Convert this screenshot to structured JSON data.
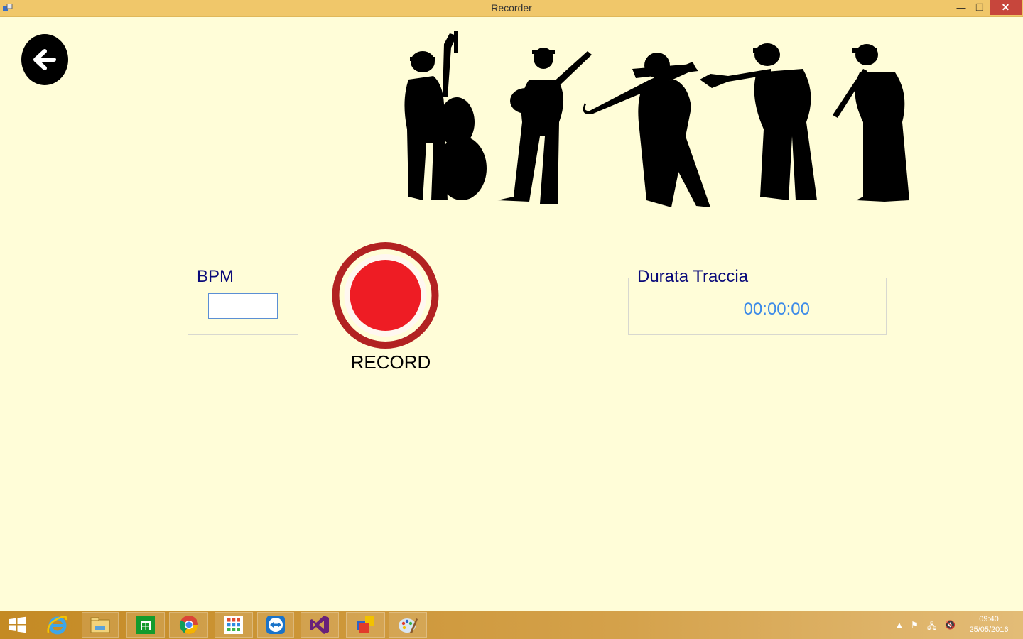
{
  "window": {
    "title": "Recorder",
    "minimize_glyph": "—",
    "maximize_glyph": "❐",
    "close_glyph": "✕"
  },
  "back": {
    "icon": "back-arrow-icon"
  },
  "bpm": {
    "label": "BPM",
    "value": "",
    "placeholder": ""
  },
  "record": {
    "label": "RECORD",
    "icon": "record-icon"
  },
  "durata": {
    "label": "Durata Traccia",
    "value": "00:00:00"
  },
  "taskbar": {
    "apps": [
      {
        "name": "windows-start-icon"
      },
      {
        "name": "internet-explorer-icon"
      },
      {
        "name": "file-explorer-icon"
      },
      {
        "name": "windows-store-icon"
      },
      {
        "name": "chrome-icon"
      },
      {
        "name": "apps-grid-icon"
      },
      {
        "name": "teamviewer-icon"
      },
      {
        "name": "visual-studio-icon"
      },
      {
        "name": "recorder-app-icon"
      },
      {
        "name": "paint-icon"
      }
    ],
    "time": "09:40",
    "date": "25/05/2016"
  },
  "colors": {
    "background": "#fffdd8",
    "titlebar": "#f0c76a",
    "record_ring": "#b22222",
    "record_dot": "#ee1c24",
    "label_text": "#0a0a7a",
    "timer_text": "#3d8be8"
  }
}
